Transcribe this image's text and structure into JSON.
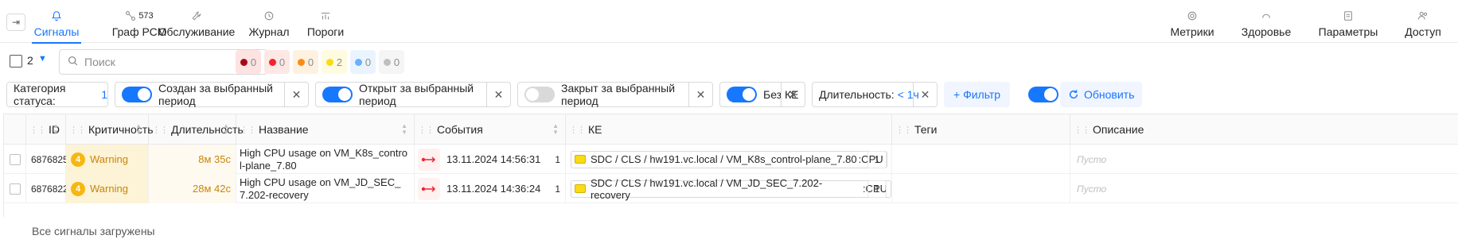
{
  "nav": {
    "tabs": [
      {
        "label": "Сигналы",
        "icon": "bell-icon",
        "active": true
      },
      {
        "label": "Граф РСМ",
        "icon": "graph-icon",
        "count": "573"
      },
      {
        "label": "Обслуживание",
        "icon": "wrench-icon"
      },
      {
        "label": "Журнал",
        "icon": "history-icon"
      },
      {
        "label": "Пороги",
        "icon": "thresholds-icon"
      }
    ],
    "right_tabs": [
      {
        "label": "Метрики",
        "icon": "metrics-icon"
      },
      {
        "label": "Здоровье",
        "icon": "health-icon"
      },
      {
        "label": "Параметры",
        "icon": "parameters-icon"
      },
      {
        "label": "Доступ",
        "icon": "users-icon"
      }
    ]
  },
  "toolbar": {
    "selected_count": "2",
    "search_placeholder": "Поиск",
    "severity_counters": [
      {
        "value": "0",
        "color": "#a8071a",
        "bg": "#fde3e1"
      },
      {
        "value": "0",
        "color": "#f5222d",
        "bg": "#fde8e6"
      },
      {
        "value": "0",
        "color": "#fa8c16",
        "bg": "#fff1e0"
      },
      {
        "value": "2",
        "color": "#fadb14",
        "bg": "#fffbe0"
      },
      {
        "value": "0",
        "color": "#69b1ff",
        "bg": "#eaf4ff"
      },
      {
        "value": "0",
        "color": "#bfbfbf",
        "bg": "#f5f5f5"
      }
    ]
  },
  "filters": {
    "status_category": {
      "label": "Категория статуса:",
      "value": "1"
    },
    "created": {
      "label": "Создан за выбранный период",
      "on": true
    },
    "opened": {
      "label": "Открыт за выбранный период",
      "on": true
    },
    "closed": {
      "label": "Закрыт за выбранный период",
      "on": false
    },
    "no_ke": {
      "label": "Без КЕ",
      "on": true
    },
    "duration": {
      "label": "Длительность:",
      "value": "< 1ч"
    },
    "add_filter": "+ Фильтр",
    "refresh": "Обновить",
    "auto_refresh_on": true
  },
  "table": {
    "columns": [
      "ID",
      "Критичность",
      "Длительность",
      "Название",
      "События",
      "КЕ",
      "Теги",
      "Описание"
    ],
    "rows": [
      {
        "id": "6876825",
        "criticality_level": "4",
        "criticality": "Warning",
        "duration": "8м 35с",
        "name": "High CPU usage on VM_K8s_control-plane_7.80",
        "event_time": "13.11.2024 14:56:31",
        "event_count": "1",
        "ke": "SDC / CLS / hw191.vc.local / VM_K8s_control-plane_7.80",
        "ke_metric": ":CPU",
        "ke_count": "1",
        "tags": "",
        "description": "Пусто"
      },
      {
        "id": "6876822",
        "criticality_level": "4",
        "criticality": "Warning",
        "duration": "28м 42с",
        "name": "High CPU usage on VM_JD_SEC_7.202-recovery",
        "event_time": "13.11.2024 14:36:24",
        "event_count": "1",
        "ke": "SDC / CLS / hw191.vc.local / VM_JD_SEC_7.202-recovery",
        "ke_metric": ":CPU",
        "ke_count": "1",
        "tags": "",
        "description": "Пусто"
      }
    ],
    "footer": "Все сигналы загружены"
  }
}
